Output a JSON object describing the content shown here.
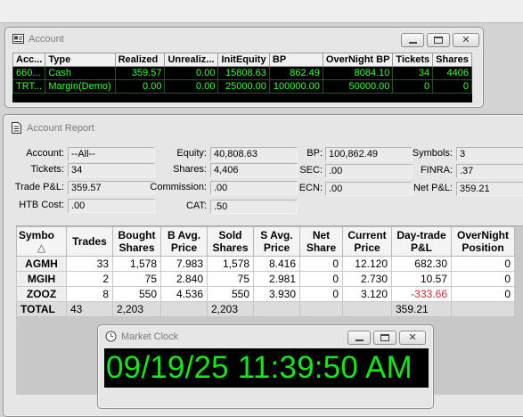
{
  "account_window": {
    "title": "Account",
    "columns": [
      "Acc...",
      "Type",
      "Realized",
      "Unrealiz...",
      "InitEquity",
      "BP",
      "OverNight BP",
      "Tickets",
      "Shares"
    ],
    "rows": [
      [
        "660...",
        "Cash",
        "359.57",
        "0.00",
        "15808.63",
        "862.49",
        "8084.10",
        "34",
        "4406"
      ],
      [
        "TRT...",
        "Margin(Demo)",
        "0.00",
        "0.00",
        "25000.00",
        "100000.00",
        "50000.00",
        "0",
        "0"
      ]
    ]
  },
  "report_window": {
    "title": "Account Report",
    "fields": {
      "account_label": "Account:",
      "account_value": "--All--",
      "tickets_label": "Tickets:",
      "tickets_value": "34",
      "tradepl_label": "Trade P&L:",
      "tradepl_value": "359.57",
      "htb_label": "HTB Cost:",
      "htb_value": ".00",
      "equity_label": "Equity:",
      "equity_value": "40,808.63",
      "shares_label": "Shares:",
      "shares_value": "4,406",
      "commission_label": "Commission:",
      "commission_value": ".00",
      "cat_label": "CAT:",
      "cat_value": ".50",
      "bp_label": "BP:",
      "bp_value": "100,862.49",
      "sec_label": "SEC:",
      "sec_value": ".00",
      "ecn_label": "ECN:",
      "ecn_value": ".00",
      "symbols_label": "Symbols:",
      "symbols_value": "3",
      "finra_label": "FINRA:",
      "finra_value": ".37",
      "netpl_label": "Net P&L:",
      "netpl_value": "359.21"
    },
    "grid": {
      "headers": [
        "Symbo",
        "Trades",
        "Bought Shares",
        "B Avg. Price",
        "Sold Shares",
        "S Avg. Price",
        "Net Share",
        "Current Price",
        "Day-trade P&L",
        "OverNight Position"
      ],
      "rows": [
        [
          "AGMH",
          "33",
          "1,578",
          "7.983",
          "1,578",
          "8.416",
          "0",
          "12.120",
          "682.30",
          "0"
        ],
        [
          "MGIH",
          "2",
          "75",
          "2.840",
          "75",
          "2.981",
          "0",
          "2.730",
          "10.57",
          "0"
        ],
        [
          "ZOOZ",
          "8",
          "550",
          "4.536",
          "550",
          "3.930",
          "0",
          "3.120",
          "-333.66",
          "0"
        ]
      ],
      "total": [
        "TOTAL",
        "43",
        "2,203",
        "",
        "2,203",
        "",
        "",
        "",
        "359.21",
        ""
      ]
    }
  },
  "clock_window": {
    "title": "Market Clock",
    "time": "09/19/25 11:39:50 AM"
  },
  "colors": {
    "grid_text_green": "#39ff39",
    "clock_green": "#13e813",
    "negative_red": "#e0203a"
  },
  "icons": {
    "minimize": "minimize-icon",
    "maximize": "maximize-icon",
    "close": "close-icon",
    "close_glyph": "✕",
    "sort": "sort-asc-icon",
    "sort_glyph": "△"
  }
}
